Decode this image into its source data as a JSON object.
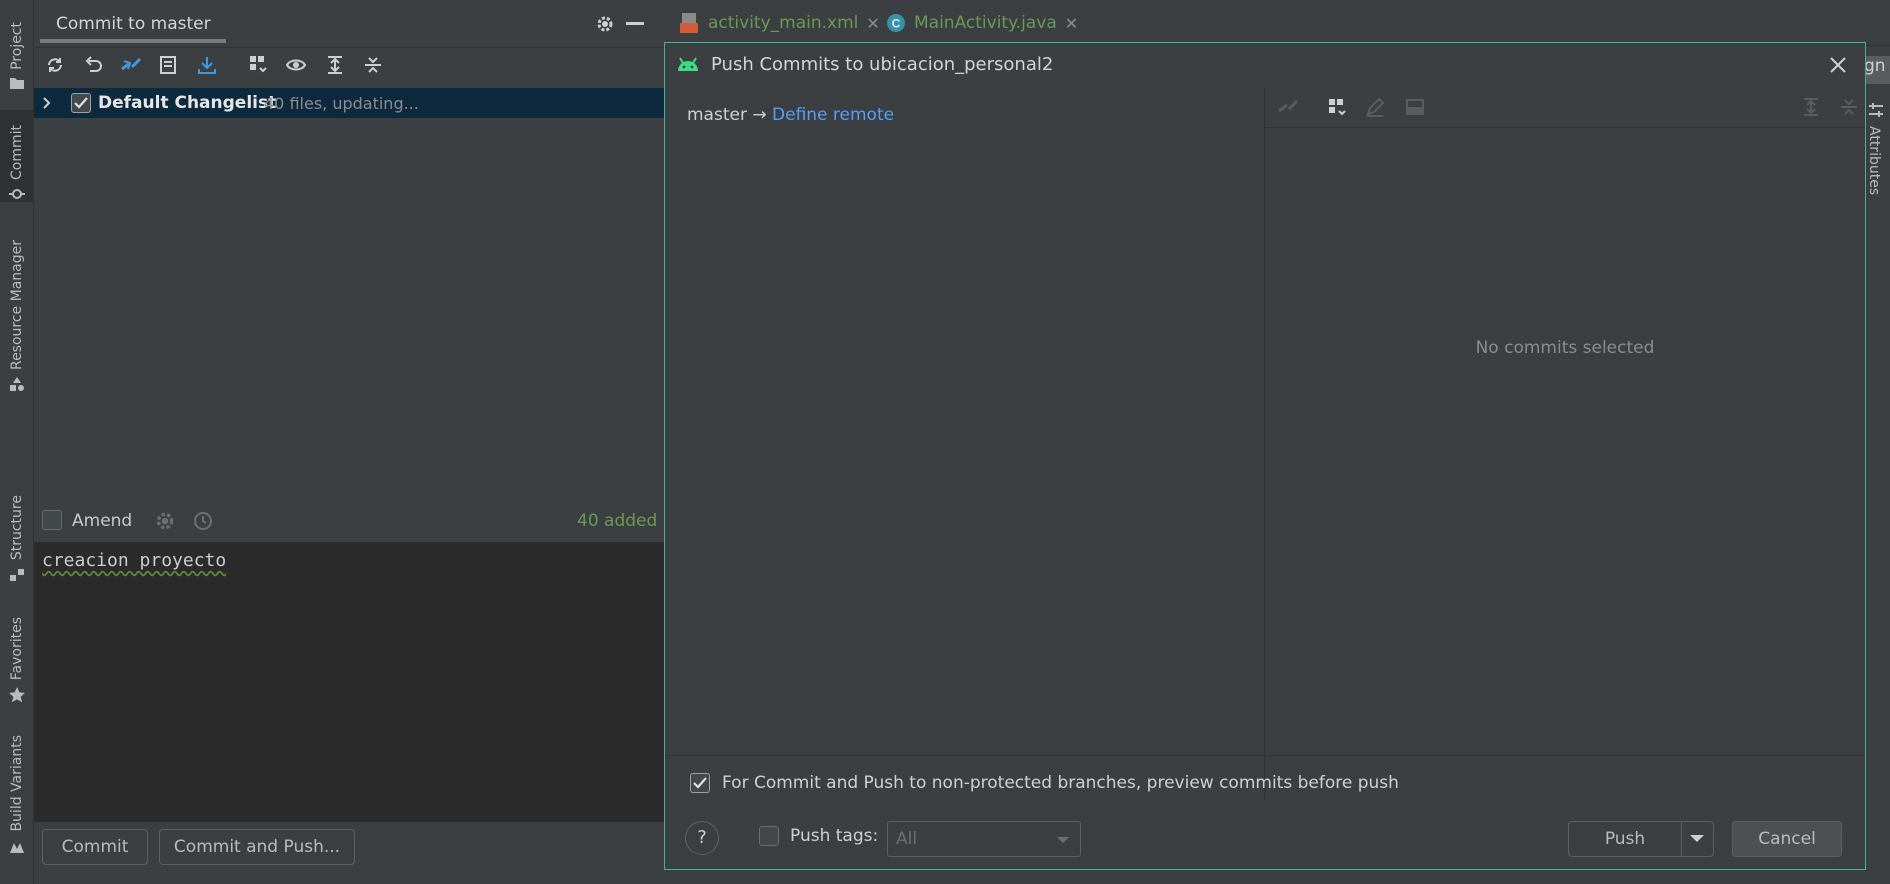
{
  "left_tool_strip": {
    "tabs": [
      {
        "label": "Project",
        "icon": "folder-icon"
      },
      {
        "label": "Commit",
        "icon": "commit-icon",
        "active": true
      },
      {
        "label": "Resource Manager",
        "icon": "resource-manager-icon"
      },
      {
        "label": "Structure",
        "icon": "structure-icon"
      },
      {
        "label": "Favorites",
        "icon": "star-icon"
      },
      {
        "label": "Build Variants",
        "icon": "build-variants-icon"
      }
    ]
  },
  "commit_panel": {
    "title": "Commit to master",
    "changelist": {
      "label": "Default Changelist",
      "status": "40 files, updating...",
      "checked": true
    },
    "amend_label": "Amend",
    "added_count": "40 added",
    "commit_message": "creacion proyecto",
    "commit_button": "Commit",
    "commit_and_push_button": "Commit and Push..."
  },
  "editor_tabs": [
    {
      "label": "activity_main.xml",
      "icon": "xml-file-icon"
    },
    {
      "label": "MainActivity.java",
      "icon": "java-class-icon"
    }
  ],
  "right_edge": {
    "design_tab_fragment": "gn",
    "attributes_label": "Attributes"
  },
  "dialog": {
    "title": "Push Commits to ubicacion_personal2",
    "branch_from": "master",
    "arrow": "→",
    "define_remote": "Define remote",
    "empty_state": "No commits selected",
    "preview_checkbox_label": "For Commit and Push to non-protected branches, preview commits before push",
    "preview_checked": true,
    "push_tags_label": "Push tags:",
    "push_tags_checked": false,
    "push_tags_value": "All",
    "push_button": "Push",
    "cancel_button": "Cancel",
    "help_label": "?"
  },
  "colors": {
    "dialog_border": "#3fb59a",
    "link": "#589df6",
    "added_green": "#6a9955",
    "selection_bg": "#0d293e",
    "android_green": "#3ddc84"
  }
}
